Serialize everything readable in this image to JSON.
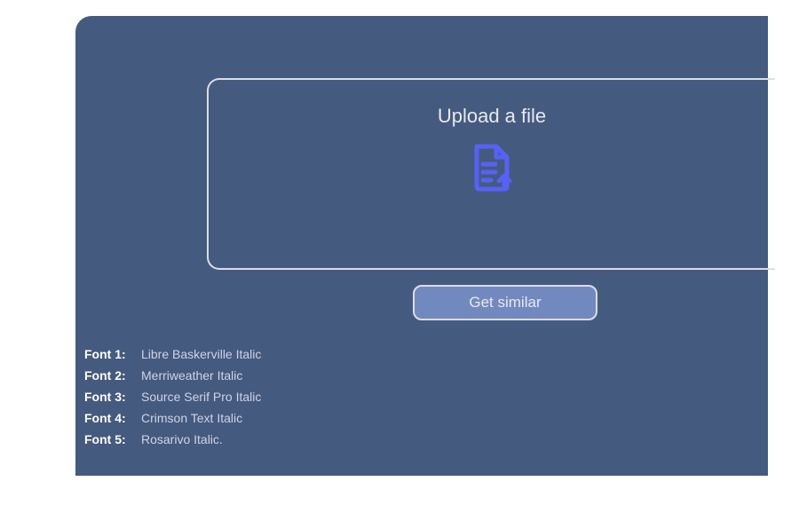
{
  "upload": {
    "title": "Upload a file",
    "icon_name": "file-upload-icon"
  },
  "actions": {
    "get_similar_label": "Get similar"
  },
  "fonts": [
    {
      "label": "Font 1:",
      "value": "Libre Baskerville Italic"
    },
    {
      "label": "Font 2:",
      "value": "Merriweather Italic"
    },
    {
      "label": "Font 3:",
      "value": "Source Serif Pro Italic"
    },
    {
      "label": "Font 4:",
      "value": "Crimson Text Italic"
    },
    {
      "label": "Font 5:",
      "value": "Rosarivo Italic."
    }
  ],
  "colors": {
    "panel_bg": "#455a7f",
    "border": "#dcdde6",
    "button_bg": "#7289bf",
    "icon": "#5761f4"
  }
}
